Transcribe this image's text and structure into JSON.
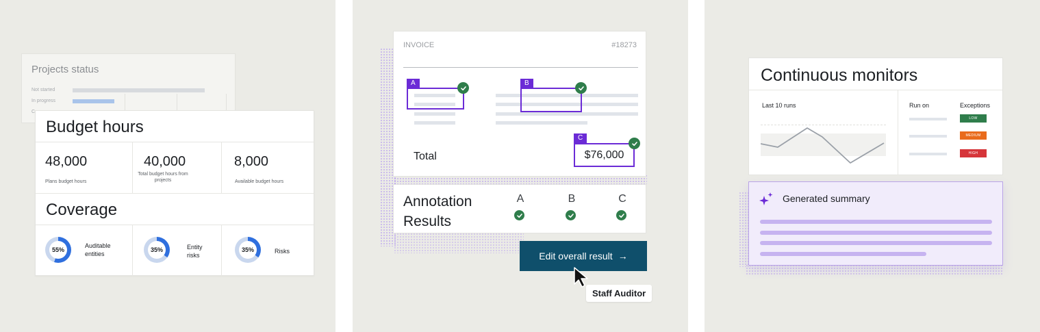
{
  "colors": {
    "panel_bg": "#ebebe6",
    "accent_purple": "#6b2bd6",
    "check_green": "#2f7d4b",
    "button_teal": "#0f4f6b",
    "donut_blue": "#2f6fde",
    "badge_low": "#2f7d4b",
    "badge_medium": "#e96b1c",
    "badge_high": "#d6353a"
  },
  "projects_status": {
    "title": "Projects status",
    "rows": [
      {
        "label": "Not started",
        "progress": 0.85
      },
      {
        "label": "In progress",
        "progress": 0.3
      },
      {
        "label": "C",
        "progress": 0
      }
    ]
  },
  "budget_hours": {
    "title": "Budget hours",
    "metrics": [
      {
        "value": "48,000",
        "label": "Plans budget hours"
      },
      {
        "value": "40,000",
        "label": "Total budget hours from projects"
      },
      {
        "value": "8,000",
        "label": "Available budget hours"
      }
    ]
  },
  "coverage": {
    "title": "Coverage",
    "items": [
      {
        "percent": "55%",
        "fraction": 0.55,
        "label": "Auditable entities"
      },
      {
        "percent": "35%",
        "fraction": 0.35,
        "label": "Entity risks"
      },
      {
        "percent": "35%",
        "fraction": 0.35,
        "label": "Risks"
      }
    ]
  },
  "invoice": {
    "label": "INVOICE",
    "number": "#18273",
    "tags": [
      "A",
      "B",
      "C"
    ],
    "total_label": "Total",
    "total_value": "$76,000"
  },
  "annotation_results": {
    "title": "Annotation Results",
    "columns": [
      "A",
      "B",
      "C"
    ]
  },
  "edit_button": {
    "label": "Edit overall result",
    "arrow": "→"
  },
  "cursor_tooltip": "Staff Auditor",
  "continuous_monitors": {
    "title": "Continuous monitors",
    "chart_label": "Last 10 runs",
    "run_on_label": "Run on",
    "exceptions_label": "Exceptions",
    "exceptions": [
      {
        "level": "LOW",
        "color": "#2f7d4b"
      },
      {
        "level": "MEDIUM",
        "color": "#e96b1c"
      },
      {
        "level": "HIGH",
        "color": "#d6353a"
      }
    ]
  },
  "generated_summary": {
    "title": "Generated summary",
    "icon": "sparkle-icon"
  }
}
